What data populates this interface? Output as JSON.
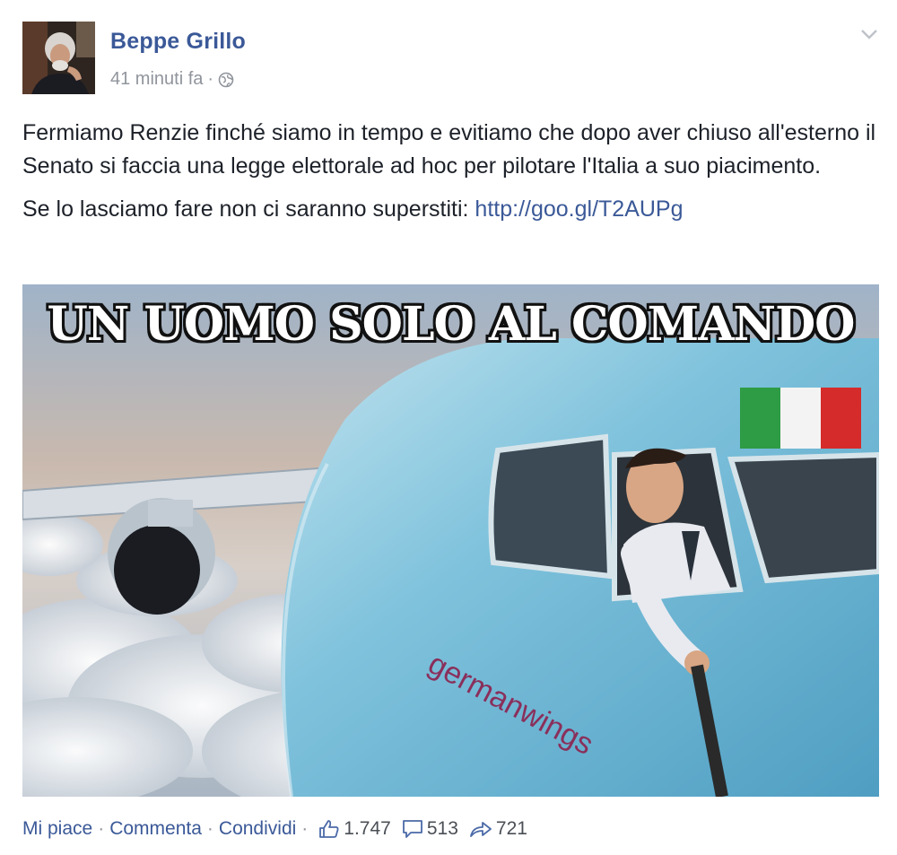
{
  "post": {
    "author": "Beppe Grillo",
    "time": "41 minuti fa",
    "separator": "·",
    "privacy_icon": "globe-icon",
    "paragraph1": "Fermiamo Renzie finché siamo in tempo e evitiamo che dopo aver chiuso all'esterno il Senato si faccia una legge elettorale ad hoc per pilotare l'Italia a suo piacimento.",
    "paragraph2_text": "Se lo lasciamo fare non ci saranno superstiti: ",
    "paragraph2_link": "http://goo.gl/T2AUPg",
    "image": {
      "caption": "UN UOMO SOLO AL COMANDO",
      "fuselage_text": "germanwings"
    }
  },
  "actions": {
    "like": "Mi piace",
    "comment": "Commenta",
    "share": "Condividi",
    "dot": "·",
    "likes_count": "1.747",
    "comments_count": "513",
    "shares_count": "721"
  },
  "colors": {
    "link": "#3b5998",
    "meta": "#90949c",
    "text": "#1d2129"
  }
}
